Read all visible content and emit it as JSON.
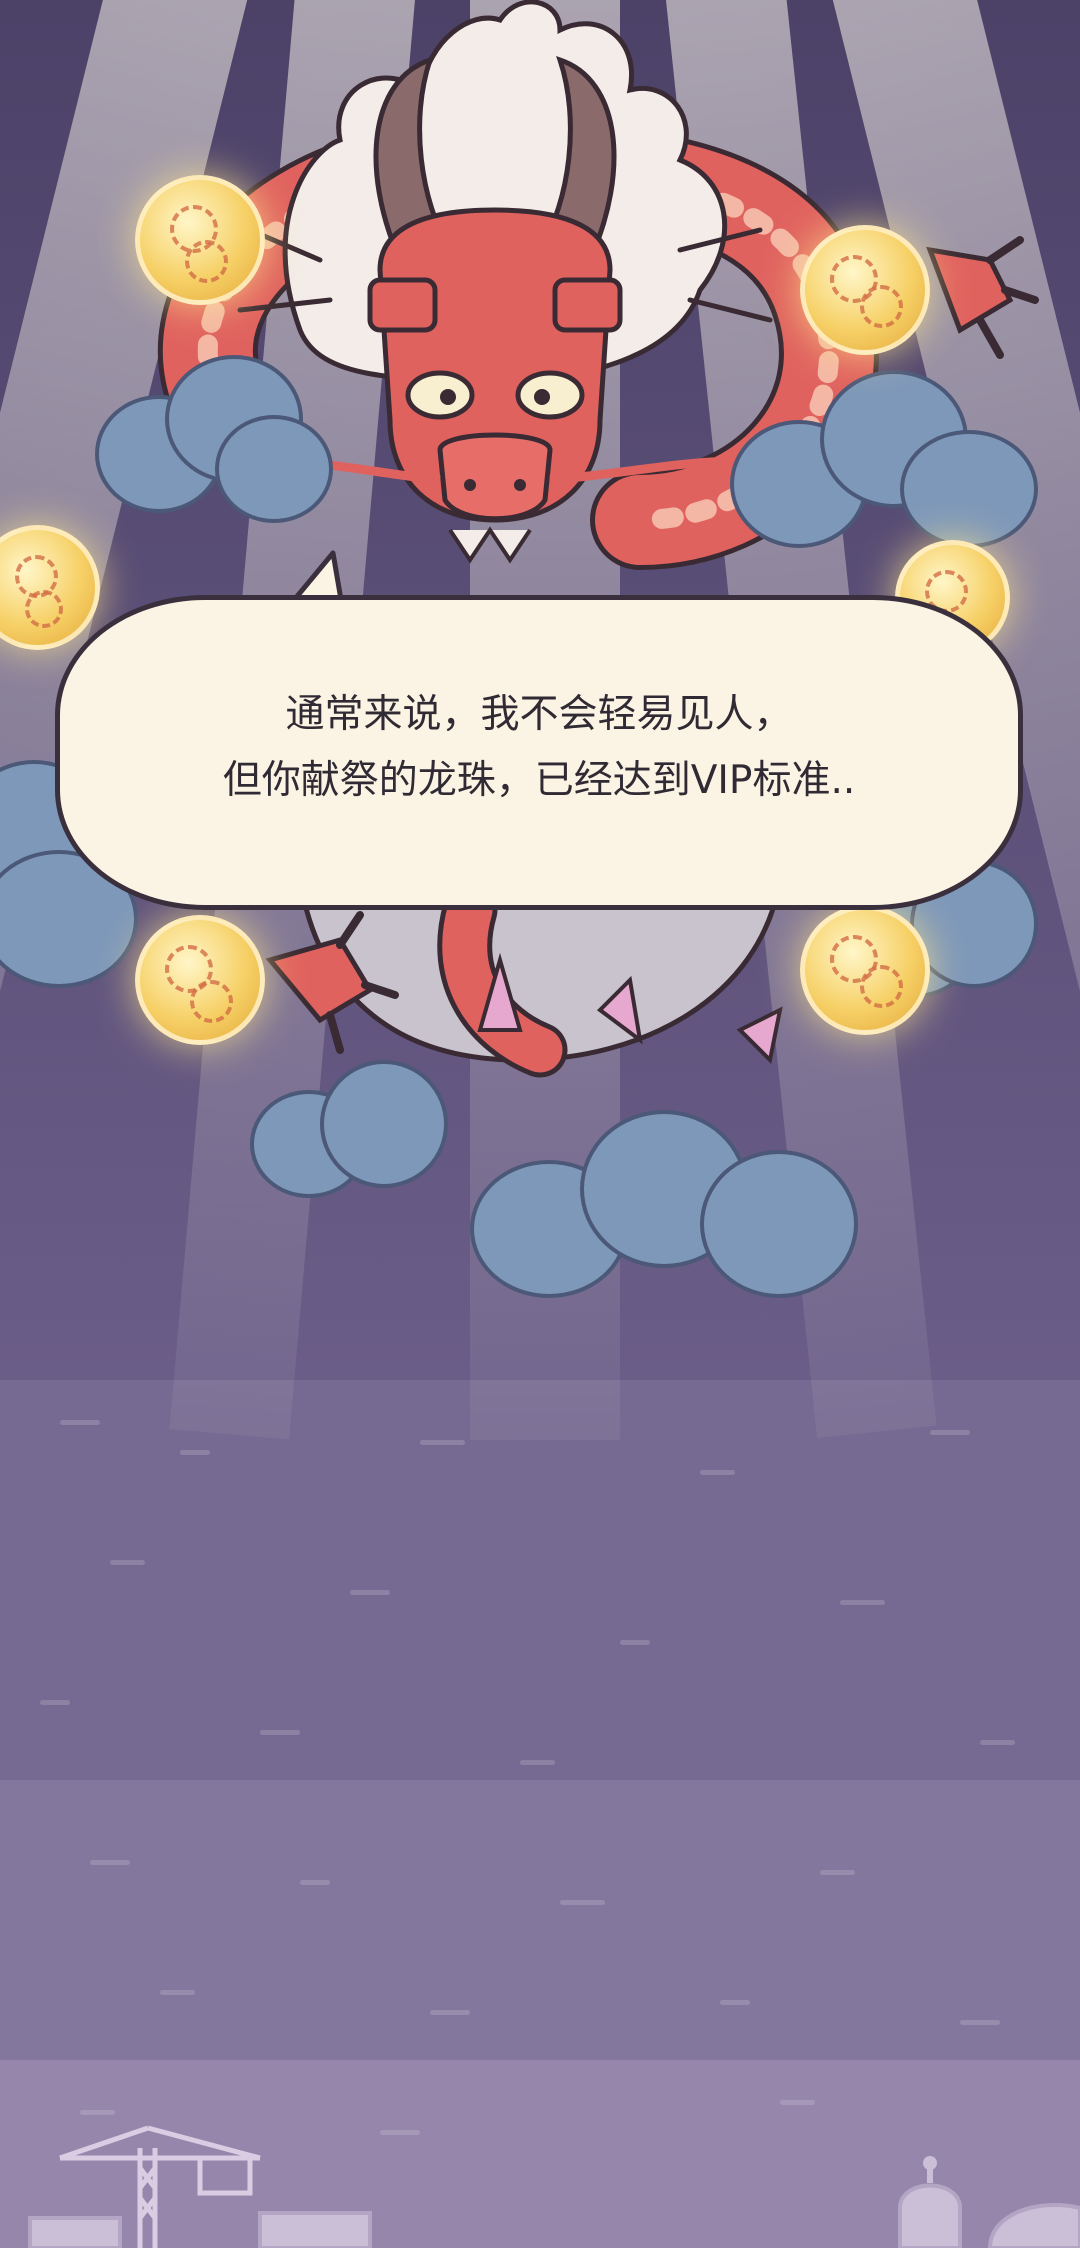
{
  "dialogue": {
    "line1": "通常来说，我不会轻易见人，",
    "line2": "但你献祭的龙珠，已经达到VIP标准.."
  },
  "scene": {
    "character": "dragon-icon",
    "items": [
      "dragon-pearl-icon",
      "cloud-icon",
      "crane-icon",
      "temple-icon"
    ]
  },
  "colors": {
    "background": "#5e5278",
    "bubble": "#fbf3e3",
    "dragon": "#e0625f",
    "cloud": "#7e98ba",
    "pearl": "#f6d066"
  }
}
